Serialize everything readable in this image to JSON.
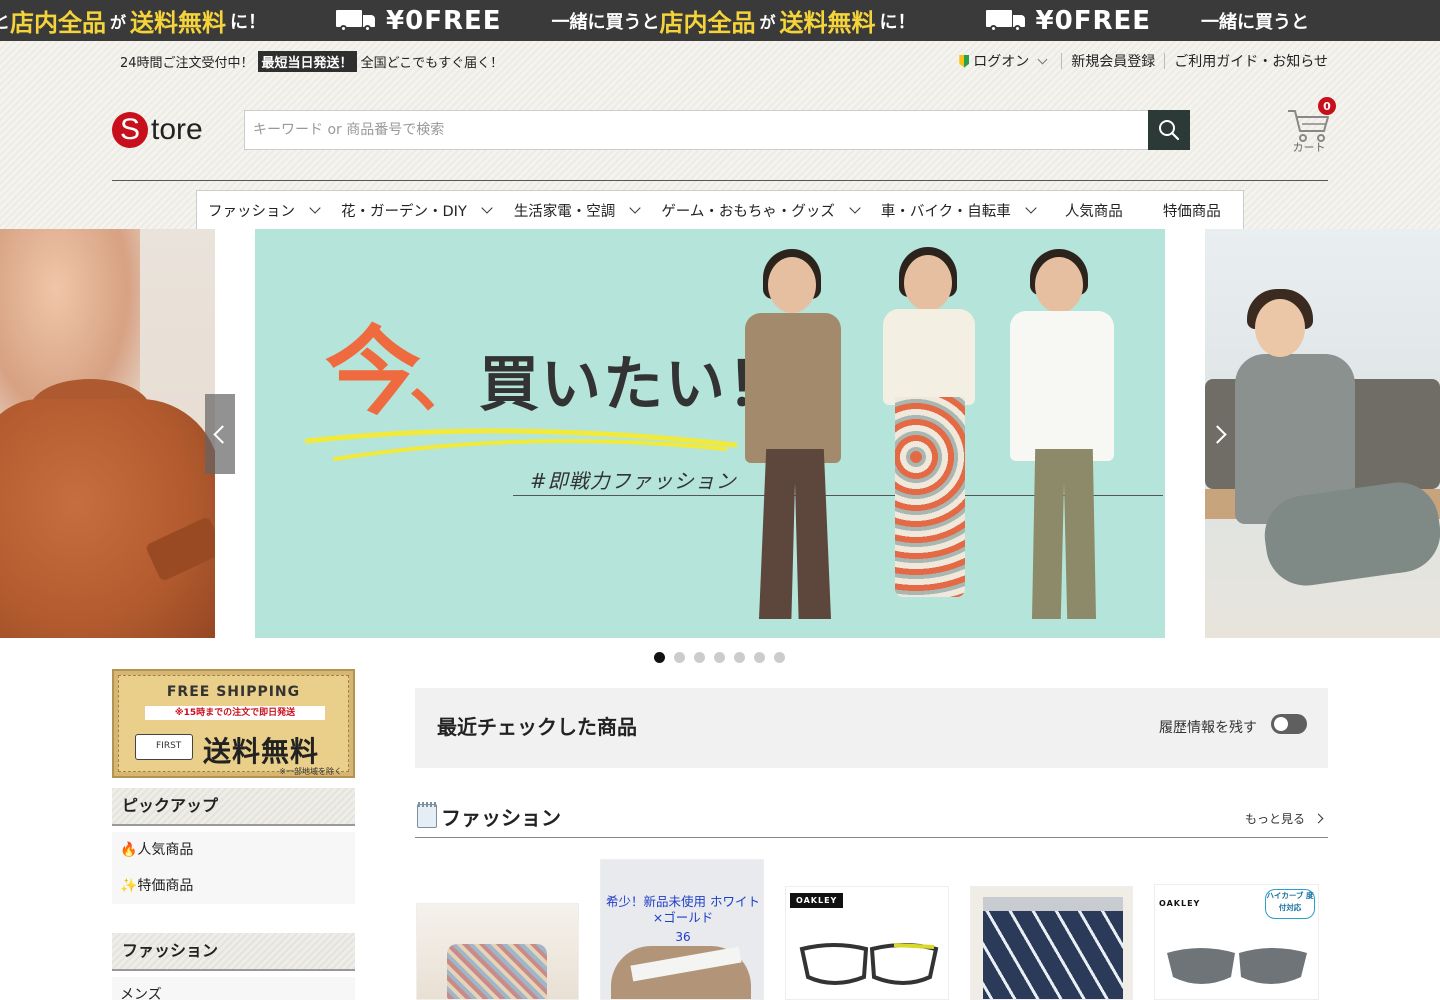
{
  "ticker": {
    "part1": "一緒に買うと",
    "part2": "店内全品",
    "part3": "が",
    "part4": "送料無料",
    "part5": "に！",
    "free": "¥0FREE"
  },
  "topbar": {
    "lead": "24時間ご注文受付中！",
    "highlight": "最短当日発送！",
    "tail": "全国どこでもすぐ届く！",
    "login": "ログオン",
    "register": "新規会員登録",
    "guide": "ご利用ガイド・お知らせ"
  },
  "logo": {
    "mark": "S",
    "text": "tore"
  },
  "search": {
    "placeholder": "キーワード or 商品番号で検索"
  },
  "cart": {
    "count": "0",
    "label": "カート"
  },
  "nav": {
    "items": [
      {
        "label": "ファッション",
        "dropdown": true
      },
      {
        "label": "花・ガーデン・DIY",
        "dropdown": true
      },
      {
        "label": "生活家電・空調",
        "dropdown": true
      },
      {
        "label": "ゲーム・おもちゃ・グッズ",
        "dropdown": true
      },
      {
        "label": "車・バイク・自転車",
        "dropdown": true
      },
      {
        "label": "人気商品",
        "dropdown": false
      },
      {
        "label": "特価商品",
        "dropdown": false
      }
    ]
  },
  "banner": {
    "headline_now": "今",
    "headline_comma": "、",
    "headline_rest": "買いたい！",
    "hashtag": "#即戦力ファッション",
    "bg": "#b5e4da",
    "accent": "#ef6a3e",
    "dots": 7,
    "active_dot": 0
  },
  "sidebar": {
    "ship": {
      "title": "FREE SHIPPING",
      "sub": "※15時までの注文で即日発送",
      "truck": "FIRST",
      "big": "送料無料",
      "note": "※一部地域を除く"
    },
    "pickup": {
      "title": "ピックアップ",
      "items": [
        "🔥人気商品",
        "✨特価商品"
      ]
    },
    "fashion": {
      "title": "ファッション",
      "items": [
        "メンズ"
      ]
    }
  },
  "recent": {
    "title": "最近チェックした商品",
    "toggle_label": "履歴情報を残す"
  },
  "section": {
    "title": "ファッション",
    "more": "もっと見る"
  },
  "products": [
    {
      "name": "product-coin-purse"
    },
    {
      "name": "product-sandals",
      "caption": "希少！新品未使用 ホワイト×ゴールド",
      "size": "36"
    },
    {
      "name": "product-glasses",
      "brand": "OAKLEY"
    },
    {
      "name": "product-shorts"
    },
    {
      "name": "product-sunglasses",
      "brand": "OAKLEY",
      "tag": "ハイカーブ 度付対応"
    }
  ],
  "colors": {
    "brand_red": "#c8101d",
    "dark": "#2b3a36",
    "ticker_bg": "#3a3a3a",
    "ticker_yellow": "#f5d33a"
  }
}
